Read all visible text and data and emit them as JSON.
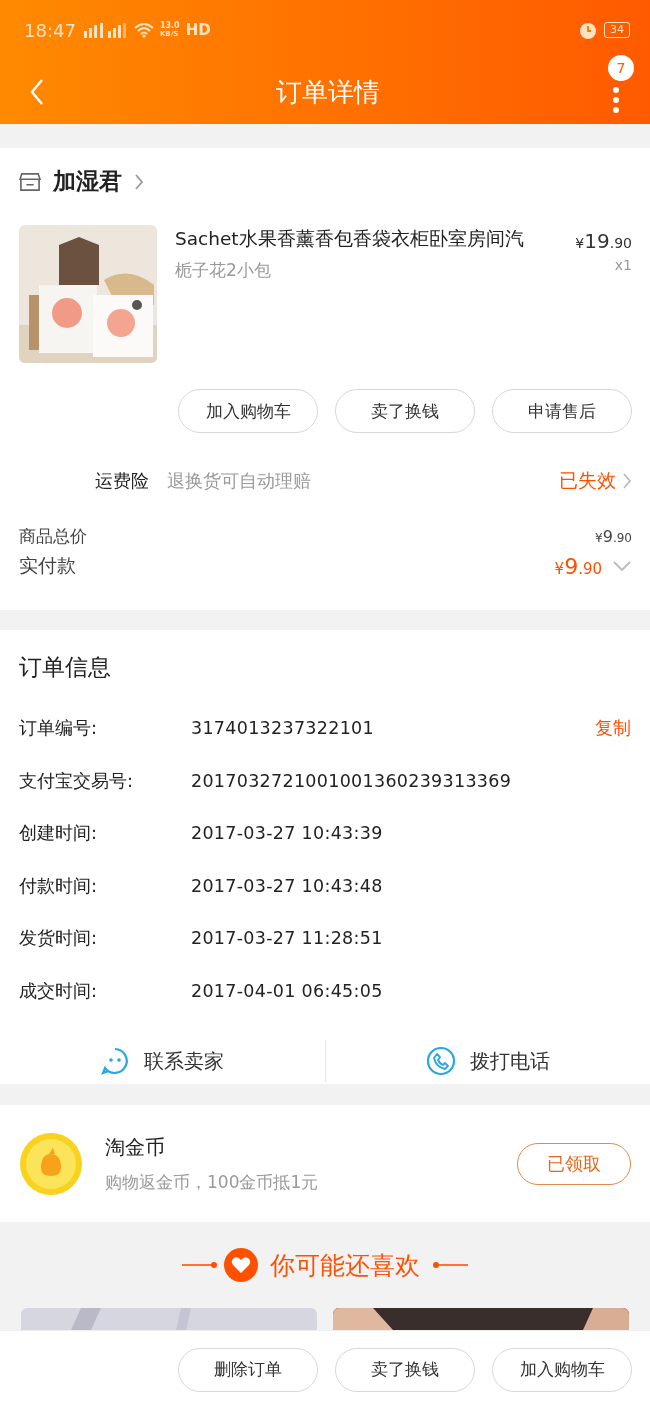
{
  "status_bar": {
    "time": "18:47",
    "speed": "13.0",
    "speed_unit": "KB/S",
    "hd": "HD",
    "battery": "34"
  },
  "header": {
    "title": "订单详情",
    "badge": "7"
  },
  "shop": {
    "name": "加湿君"
  },
  "product": {
    "kind": "picture",
    "title": "Sachet水果香薰香包香袋衣柜卧室房间汽",
    "spec": "栀子花2小包",
    "price": {
      "currency": "¥",
      "integer": "19",
      "decimal": ".90"
    },
    "quantity": "x1"
  },
  "actions": [
    "加入购物车",
    "卖了换钱",
    "申请售后"
  ],
  "insurance": {
    "label": "运费险",
    "description": "退换货可自动理赔",
    "status": "已失效"
  },
  "totals": {
    "label": "商品总价",
    "value": {
      "currency": "¥",
      "integer": "9",
      "decimal": ".90"
    }
  },
  "paid": {
    "label": "实付款",
    "value": {
      "currency": "¥",
      "integer": "9",
      "decimal": ".90"
    }
  },
  "order_info": {
    "title": "订单信息",
    "rows": [
      {
        "label": "订单编号:",
        "value": "3174013237322101",
        "action": "复制"
      },
      {
        "label": "支付宝交易号:",
        "value": "2017032721001001360239313369"
      },
      {
        "label": "创建时间:",
        "value": "2017-03-27 10:43:39"
      },
      {
        "label": "付款时间:",
        "value": "2017-03-27 10:43:48"
      },
      {
        "label": "发货时间:",
        "value": "2017-03-27 11:28:51"
      },
      {
        "label": "成交时间:",
        "value": "2017-04-01 06:45:05"
      }
    ]
  },
  "contact": [
    {
      "kind": "chat",
      "label": "联系卖家"
    },
    {
      "kind": "phone",
      "label": "拨打电话"
    }
  ],
  "coins": {
    "title": "淘金币",
    "description": "购物返金币，100金币抵1元",
    "button": "已领取"
  },
  "recommend": {
    "title": "你可能还喜欢"
  },
  "bottom_bar": {
    "buttons": [
      "删除订单",
      "卖了换钱",
      "加入购物车"
    ]
  }
}
